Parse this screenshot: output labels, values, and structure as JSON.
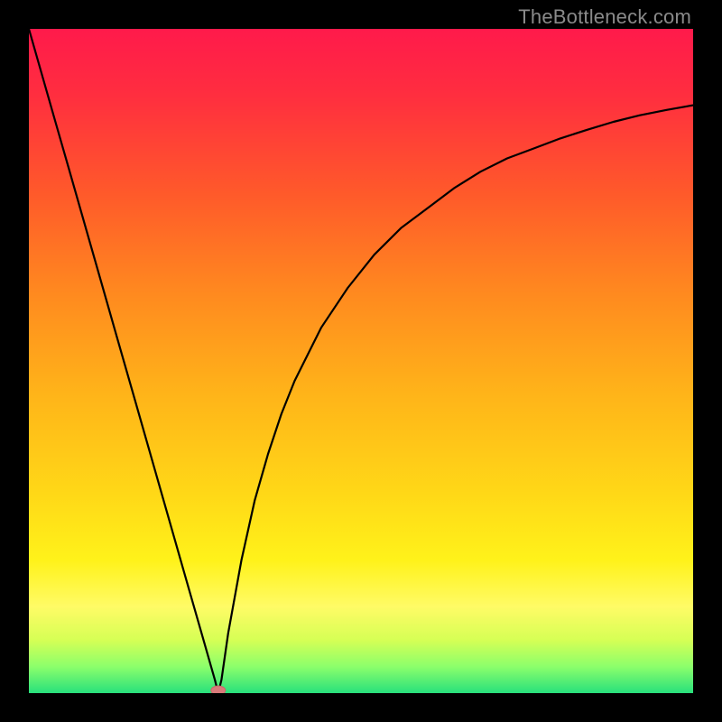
{
  "watermark": "TheBottleneck.com",
  "colors": {
    "gradient_stops": [
      {
        "offset": 0.0,
        "color": "#ff1a4b"
      },
      {
        "offset": 0.1,
        "color": "#ff2e3f"
      },
      {
        "offset": 0.25,
        "color": "#ff5a2a"
      },
      {
        "offset": 0.4,
        "color": "#ff8a1f"
      },
      {
        "offset": 0.55,
        "color": "#ffb419"
      },
      {
        "offset": 0.7,
        "color": "#ffd817"
      },
      {
        "offset": 0.8,
        "color": "#fff21a"
      },
      {
        "offset": 0.87,
        "color": "#fffb66"
      },
      {
        "offset": 0.92,
        "color": "#d6ff55"
      },
      {
        "offset": 0.96,
        "color": "#8cff6b"
      },
      {
        "offset": 1.0,
        "color": "#28e07c"
      }
    ],
    "curve": "#000000",
    "marker": "#d97a7a",
    "frame": "#000000"
  },
  "chart_data": {
    "type": "line",
    "title": "",
    "xlabel": "",
    "ylabel": "",
    "xlim": [
      0,
      100
    ],
    "ylim": [
      0,
      100
    ],
    "grid": false,
    "legend": false,
    "x": [
      0,
      2,
      4,
      6,
      8,
      10,
      12,
      14,
      16,
      18,
      20,
      22,
      24,
      26,
      28,
      28.5,
      29,
      30,
      32,
      34,
      36,
      38,
      40,
      44,
      48,
      52,
      56,
      60,
      64,
      68,
      72,
      76,
      80,
      84,
      88,
      92,
      96,
      100
    ],
    "y": [
      100,
      93,
      86,
      79,
      72,
      65,
      58,
      51,
      44,
      37,
      30,
      23,
      16,
      9,
      2,
      0,
      2,
      9,
      20,
      29,
      36,
      42,
      47,
      55,
      61,
      66,
      70,
      73,
      76,
      78.5,
      80.5,
      82,
      83.5,
      84.8,
      86,
      87,
      87.8,
      88.5
    ],
    "marker": {
      "x": 28.5,
      "y": 0
    },
    "notes": "V-shaped bottleneck curve over red→green vertical gradient background. Values are read off the normalized 0–100 axes (no tick labels shown in the image; units are percent of plot area)."
  }
}
